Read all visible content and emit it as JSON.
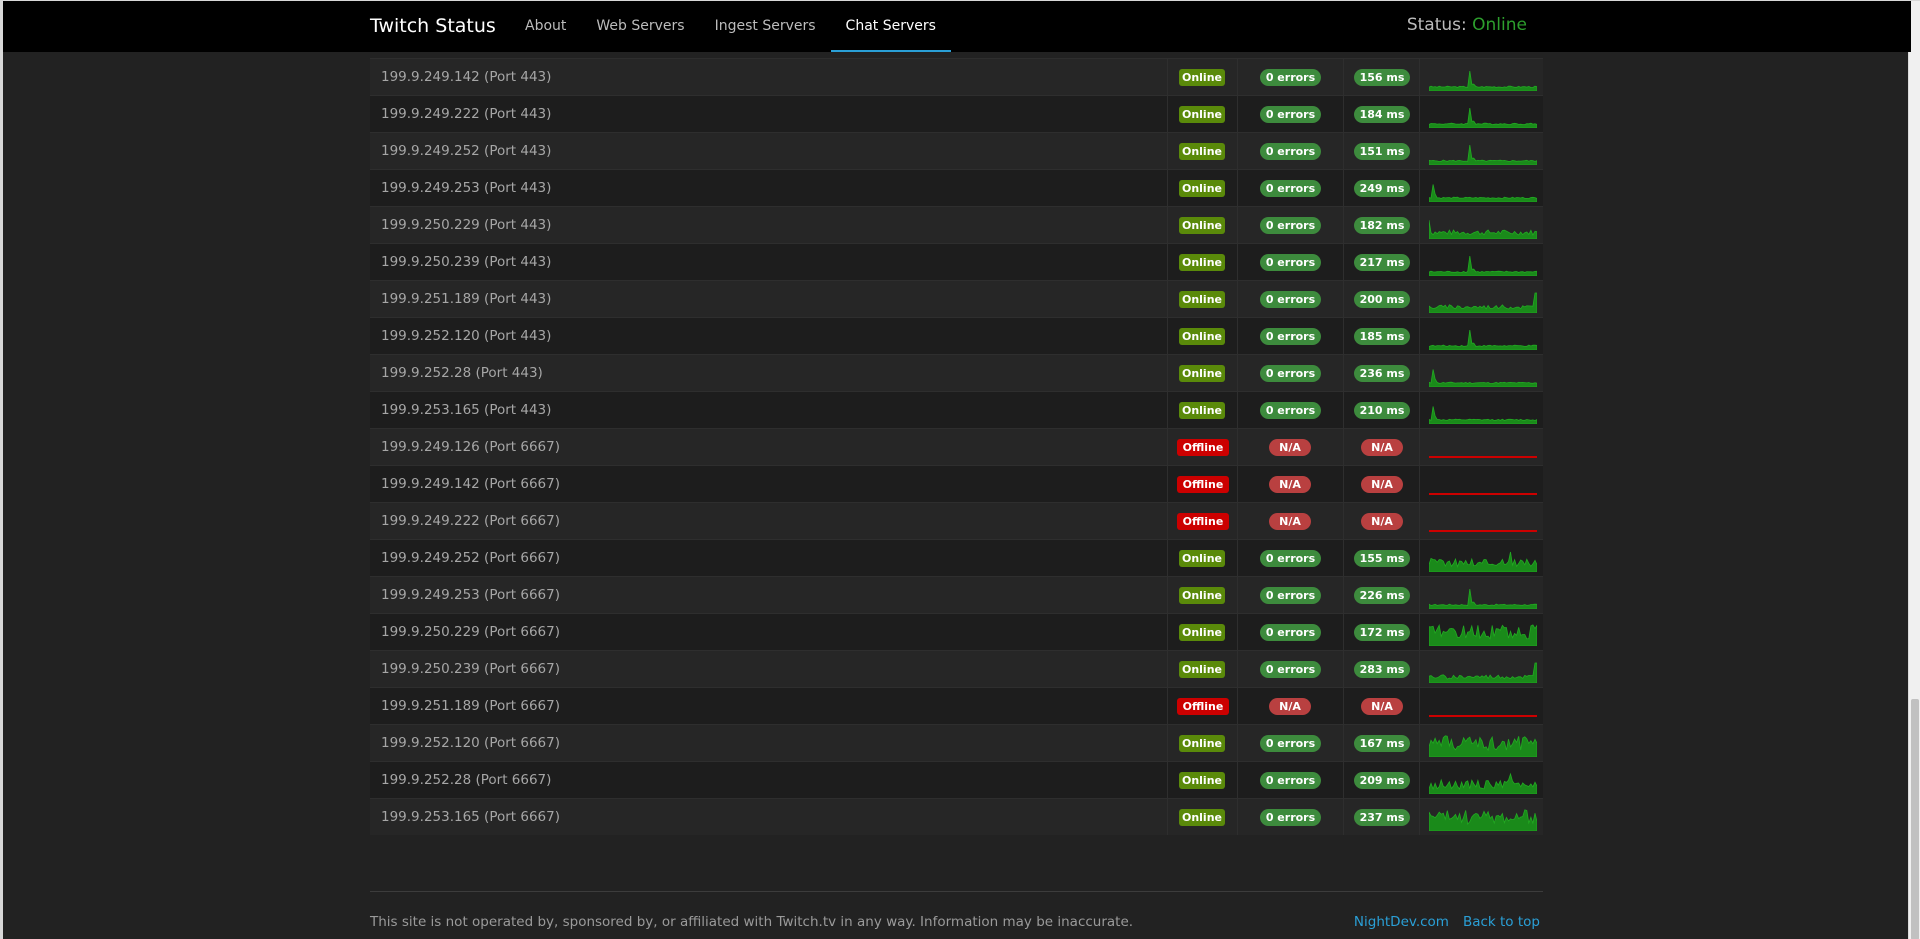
{
  "nav": {
    "brand": "Twitch Status",
    "links": [
      "About",
      "Web Servers",
      "Ingest Servers",
      "Chat Servers"
    ],
    "active": "Chat Servers",
    "status_label": "Status:",
    "status_value": "Online"
  },
  "servers": [
    {
      "name": "199.9.249.142 (Port 443)",
      "status": "Online",
      "errors": "0 errors",
      "ping": "156 ms",
      "graph": "spike"
    },
    {
      "name": "199.9.249.222 (Port 443)",
      "status": "Online",
      "errors": "0 errors",
      "ping": "184 ms",
      "graph": "spike"
    },
    {
      "name": "199.9.249.252 (Port 443)",
      "status": "Online",
      "errors": "0 errors",
      "ping": "151 ms",
      "graph": "spike"
    },
    {
      "name": "199.9.249.253 (Port 443)",
      "status": "Online",
      "errors": "0 errors",
      "ping": "249 ms",
      "graph": "spike-left"
    },
    {
      "name": "199.9.250.229 (Port 443)",
      "status": "Online",
      "errors": "0 errors",
      "ping": "182 ms",
      "graph": "noisy"
    },
    {
      "name": "199.9.250.239 (Port 443)",
      "status": "Online",
      "errors": "0 errors",
      "ping": "217 ms",
      "graph": "spike"
    },
    {
      "name": "199.9.251.189 (Port 443)",
      "status": "Online",
      "errors": "0 errors",
      "ping": "200 ms",
      "graph": "rising"
    },
    {
      "name": "199.9.252.120 (Port 443)",
      "status": "Online",
      "errors": "0 errors",
      "ping": "185 ms",
      "graph": "spike"
    },
    {
      "name": "199.9.252.28 (Port 443)",
      "status": "Online",
      "errors": "0 errors",
      "ping": "236 ms",
      "graph": "spike-left"
    },
    {
      "name": "199.9.253.165 (Port 443)",
      "status": "Online",
      "errors": "0 errors",
      "ping": "210 ms",
      "graph": "spike-left"
    },
    {
      "name": "199.9.249.126 (Port 6667)",
      "status": "Offline",
      "errors": "N/A",
      "ping": "N/A",
      "graph": "flat"
    },
    {
      "name": "199.9.249.142 (Port 6667)",
      "status": "Offline",
      "errors": "N/A",
      "ping": "N/A",
      "graph": "flat"
    },
    {
      "name": "199.9.249.222 (Port 6667)",
      "status": "Offline",
      "errors": "N/A",
      "ping": "N/A",
      "graph": "flat"
    },
    {
      "name": "199.9.249.252 (Port 6667)",
      "status": "Online",
      "errors": "0 errors",
      "ping": "155 ms",
      "graph": "busy"
    },
    {
      "name": "199.9.249.253 (Port 6667)",
      "status": "Online",
      "errors": "0 errors",
      "ping": "226 ms",
      "graph": "spike"
    },
    {
      "name": "199.9.250.229 (Port 6667)",
      "status": "Online",
      "errors": "0 errors",
      "ping": "172 ms",
      "graph": "dense"
    },
    {
      "name": "199.9.250.239 (Port 6667)",
      "status": "Online",
      "errors": "0 errors",
      "ping": "283 ms",
      "graph": "rising"
    },
    {
      "name": "199.9.251.189 (Port 6667)",
      "status": "Offline",
      "errors": "N/A",
      "ping": "N/A",
      "graph": "flat"
    },
    {
      "name": "199.9.252.120 (Port 6667)",
      "status": "Online",
      "errors": "0 errors",
      "ping": "167 ms",
      "graph": "dense"
    },
    {
      "name": "199.9.252.28 (Port 6667)",
      "status": "Online",
      "errors": "0 errors",
      "ping": "209 ms",
      "graph": "busy"
    },
    {
      "name": "199.9.253.165 (Port 6667)",
      "status": "Online",
      "errors": "0 errors",
      "ping": "237 ms",
      "graph": "dense"
    }
  ],
  "footer": {
    "disclaimer": "This site is not operated by, sponsored by, or affiliated with Twitch.tv in any way. Information may be inaccurate.",
    "link_nightdev": "NightDev.com",
    "link_top": "Back to top"
  },
  "colors": {
    "online_label": "#5a8a0a",
    "offline_label": "#cc0000",
    "ok_pill": "#3d8b3d",
    "na_pill": "#b94040",
    "graph_green": "#1a8a1a",
    "graph_red": "#cc0000",
    "accent": "#2a9fd6"
  }
}
